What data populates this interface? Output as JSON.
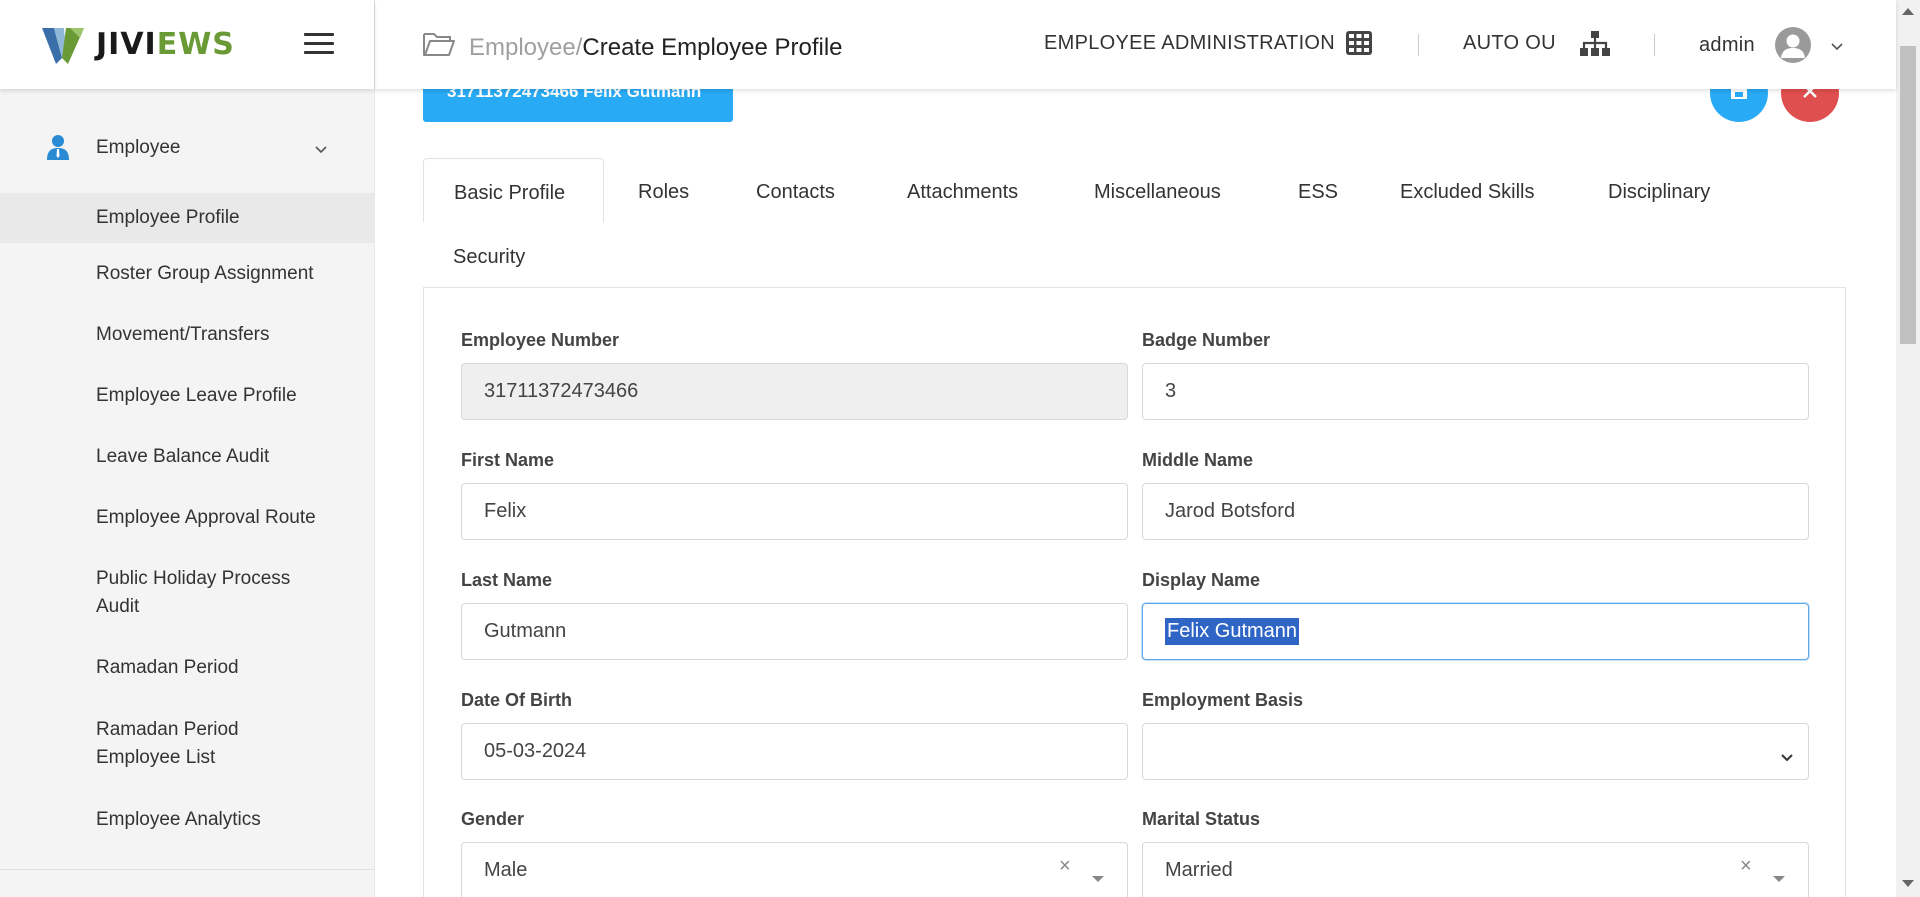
{
  "app": {
    "logo_part1": "JIVI",
    "logo_part2": "EWS"
  },
  "sidebar": {
    "group": {
      "label": "Employee"
    },
    "items": [
      {
        "label": "Employee Profile",
        "active": true
      },
      {
        "label": "Roster Group Assignment"
      },
      {
        "label": "Movement/Transfers"
      },
      {
        "label": "Employee Leave Profile"
      },
      {
        "label": "Leave Balance Audit"
      },
      {
        "label": "Employee Approval Route"
      },
      {
        "label": "Public Holiday Process Audit"
      },
      {
        "label": "Ramadan Period"
      },
      {
        "label": "Ramadan Period Employee List"
      },
      {
        "label": "Employee Analytics"
      }
    ]
  },
  "header": {
    "breadcrumb_parent": "Employee",
    "breadcrumb_sep": "/",
    "breadcrumb_current": "Create Employee Profile",
    "module": "EMPLOYEE ADMINISTRATION",
    "org_unit": "AUTO OU",
    "user": "admin"
  },
  "banner": {
    "text": "31711372473466 Felix Gutmann"
  },
  "tabs": [
    {
      "label": "Basic Profile",
      "active": true
    },
    {
      "label": "Roles"
    },
    {
      "label": "Contacts"
    },
    {
      "label": "Attachments"
    },
    {
      "label": "Miscellaneous"
    },
    {
      "label": "ESS"
    },
    {
      "label": "Excluded Skills"
    },
    {
      "label": "Disciplinary"
    },
    {
      "label": "Security"
    }
  ],
  "form": {
    "employee_number": {
      "label": "Employee Number",
      "value": "31711372473466"
    },
    "badge_number": {
      "label": "Badge Number",
      "value": "3"
    },
    "first_name": {
      "label": "First Name",
      "value": "Felix"
    },
    "middle_name": {
      "label": "Middle Name",
      "value": "Jarod Botsford"
    },
    "last_name": {
      "label": "Last Name",
      "value": "Gutmann"
    },
    "display_name": {
      "label": "Display Name",
      "value": "Felix Gutmann"
    },
    "date_of_birth": {
      "label": "Date Of Birth",
      "value": "05-03-2024"
    },
    "employment_basis": {
      "label": "Employment Basis",
      "value": ""
    },
    "gender": {
      "label": "Gender",
      "value": "Male",
      "clear": "×"
    },
    "marital_status": {
      "label": "Marital Status",
      "value": "Married",
      "clear": "×"
    }
  },
  "colors": {
    "accent": "#29aaf4",
    "danger": "#e04f4f",
    "brand_green": "#6a9a35",
    "selection": "#2f66c6"
  }
}
